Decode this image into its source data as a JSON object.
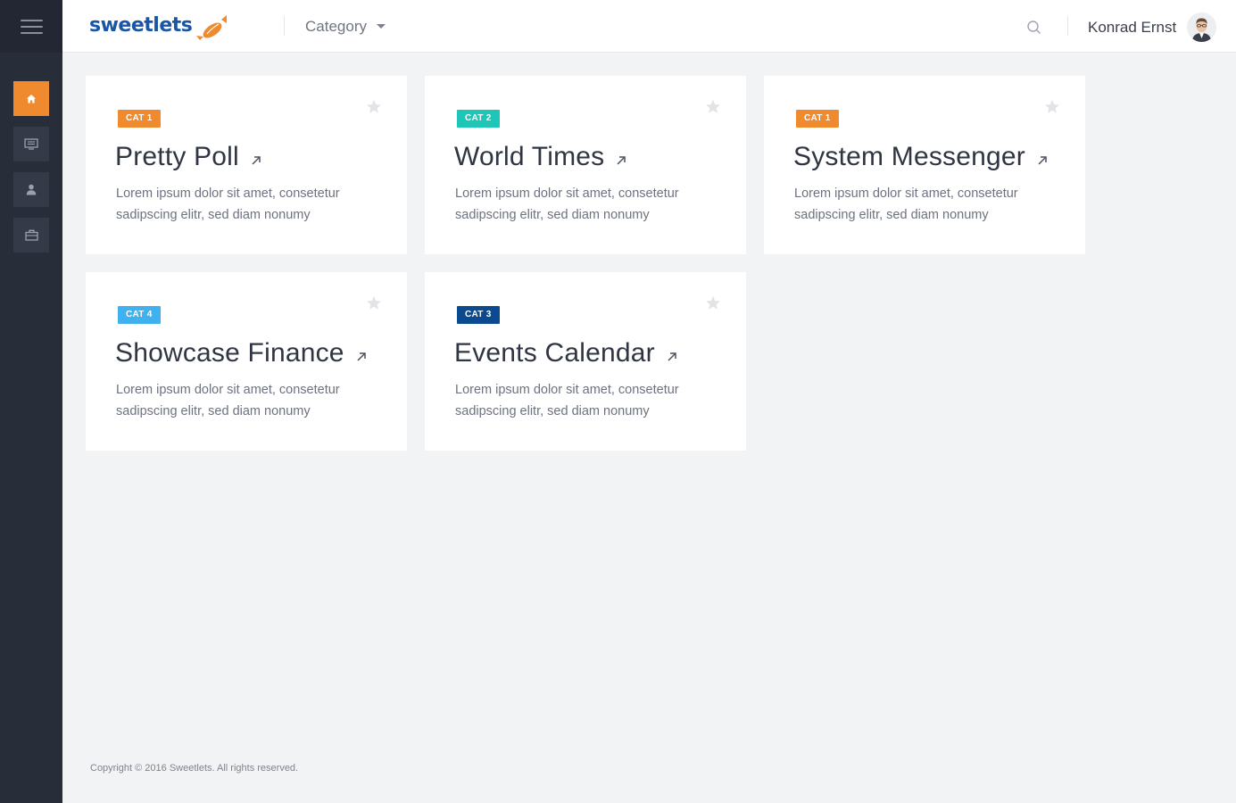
{
  "app": {
    "logo_text": "sweetlets",
    "category_label": "Category",
    "user_name": "Konrad Ernst"
  },
  "sidebar": {
    "items": [
      {
        "icon": "home-icon",
        "active": true
      },
      {
        "icon": "monitor-icon",
        "active": false
      },
      {
        "icon": "user-icon",
        "active": false
      },
      {
        "icon": "briefcase-icon",
        "active": false
      }
    ]
  },
  "colors": {
    "accent": "#f08a2f",
    "sidebar": "#282d3a",
    "logo": "#1a56a6"
  },
  "cards": [
    {
      "badge": "CAT 1",
      "badge_color": "#f08a2f",
      "title": "Pretty Poll",
      "description": "Lorem ipsum dolor sit amet, consetetur sadipscing elitr, sed diam nonumy"
    },
    {
      "badge": "CAT 2",
      "badge_color": "#1ec6b8",
      "title": "World Times",
      "description": "Lorem ipsum dolor sit amet, consetetur sadipscing elitr, sed diam nonumy"
    },
    {
      "badge": "CAT 1",
      "badge_color": "#f08a2f",
      "title": "System Messenger",
      "description": "Lorem ipsum dolor sit amet, consetetur sadipscing elitr, sed diam nonumy"
    },
    {
      "badge": "CAT 4",
      "badge_color": "#3fb1ee",
      "title": "Showcase Finance",
      "description": "Lorem ipsum dolor sit amet, consetetur sadipscing elitr, sed diam nonumy"
    },
    {
      "badge": "CAT 3",
      "badge_color": "#0b4a8f",
      "title": "Events Calendar",
      "description": "Lorem ipsum dolor sit amet, consetetur sadipscing elitr, sed diam nonumy"
    }
  ],
  "footer": {
    "copyright": "Copyright © 2016 Sweetlets. All rights reserved."
  }
}
